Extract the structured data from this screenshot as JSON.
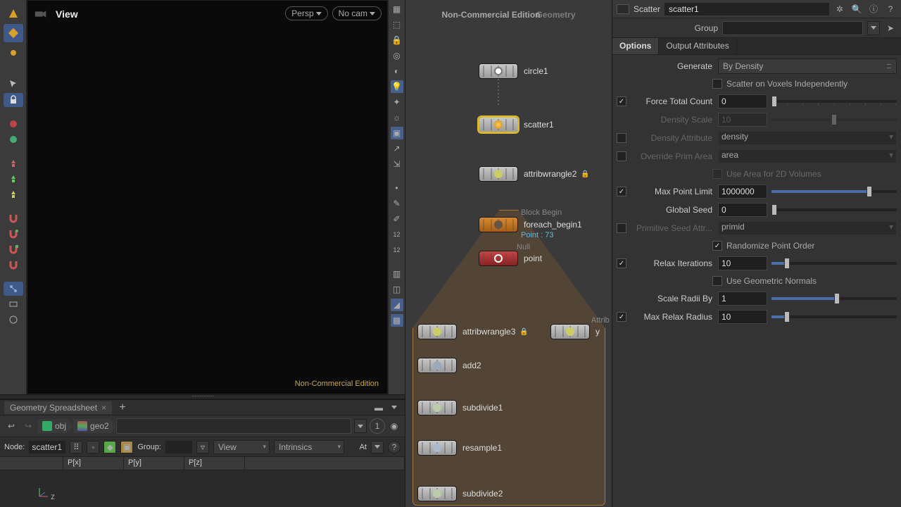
{
  "viewport": {
    "title": "View",
    "persp_button": "Persp",
    "cam_button": "No cam",
    "nc_label": "Non-Commercial Edition",
    "axis_label": "z"
  },
  "ghost_title": {
    "a": "Non-Commercial Edition",
    "b": "Geometry"
  },
  "spreadsheet": {
    "tab": "Geometry Spreadsheet",
    "path_obj": "obj",
    "path_geo": "geo2",
    "node_label": "Node:",
    "node_value": "scatter1",
    "group_label": "Group:",
    "view_label": "View",
    "intrinsics_label": "Intrinsics",
    "at_label": "At",
    "headers": [
      "",
      "P[x]",
      "P[y]",
      "P[z]",
      ""
    ]
  },
  "circle_badge": "1",
  "nodes": {
    "circle": "circle1",
    "scatter": "scatter1",
    "aw2": "attribwrangle2",
    "block_tag": "Block Begin",
    "foreach": "foreach_begin1",
    "point_count": "Point : 73",
    "null_tag": "Null",
    "point": "point",
    "aw3": "attribwrangle3",
    "aw_right_tag": "Attrib",
    "aw_right": "y",
    "add2": "add2",
    "sub1": "subdivide1",
    "resample": "resample1",
    "sub2": "subdivide2"
  },
  "params": {
    "type": "Scatter",
    "name": "scatter1",
    "group_label": "Group",
    "tabs": [
      "Options",
      "Output Attributes"
    ],
    "generate": {
      "label": "Generate",
      "value": "By Density"
    },
    "scatter_voxels": "Scatter on Voxels Independently",
    "force_total": {
      "label": "Force Total Count",
      "value": "0"
    },
    "density_scale": {
      "label": "Density Scale",
      "value": "10"
    },
    "density_attr": {
      "label": "Density Attribute",
      "value": "density"
    },
    "override_prim": {
      "label": "Override Prim Area",
      "value": "area"
    },
    "use_area_2d": "Use Area for 2D Volumes",
    "max_point": {
      "label": "Max Point Limit",
      "value": "1000000"
    },
    "global_seed": {
      "label": "Global Seed",
      "value": "0"
    },
    "prim_seed": {
      "label": "Primitive Seed Attr...",
      "value": "primid"
    },
    "randomize": "Randomize Point Order",
    "relax_iter": {
      "label": "Relax Iterations",
      "value": "10"
    },
    "geom_normals": "Use Geometric Normals",
    "scale_radii": {
      "label": "Scale Radii By",
      "value": "1"
    },
    "max_relax": {
      "label": "Max Relax Radius",
      "value": "10"
    }
  }
}
